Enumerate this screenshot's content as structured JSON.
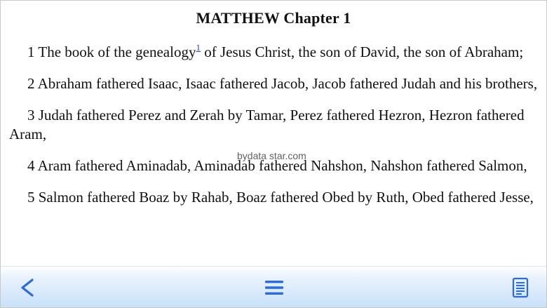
{
  "reader": {
    "title": "MATTHEW Chapter 1",
    "verses": [
      {
        "pre": "1 The book of the genealogy",
        "footnote": "1",
        "post": " of Jesus Christ, the son of David, the son of Abraham;"
      },
      {
        "text": "2 Abraham fathered Isaac, Isaac fathered Jacob, Jacob fathered Judah and his brothers,"
      },
      {
        "text": "3 Judah fathered Perez and Zerah by Tamar, Perez fathered Hezron, Hezron fathered Aram,"
      },
      {
        "text": "4 Aram fathered Aminadab, Aminadab fathered Nahshon, Nahshon fathered Salmon,"
      },
      {
        "text": "5 Salmon fathered Boaz by Rahab, Boaz fathered Obed by Ruth, Obed fathered Jesse,"
      }
    ],
    "watermark": "bydata star.com"
  },
  "toolbar": {
    "back_icon": "chevron-left-icon",
    "menu_icon": "hamburger-menu-icon",
    "toc_icon": "list-document-icon"
  },
  "colors": {
    "accent": "#2b6be0",
    "footnote_link": "#2b43c8",
    "toolbar_top": "#eaf3fd",
    "toolbar_bottom": "#c8e0fa"
  }
}
